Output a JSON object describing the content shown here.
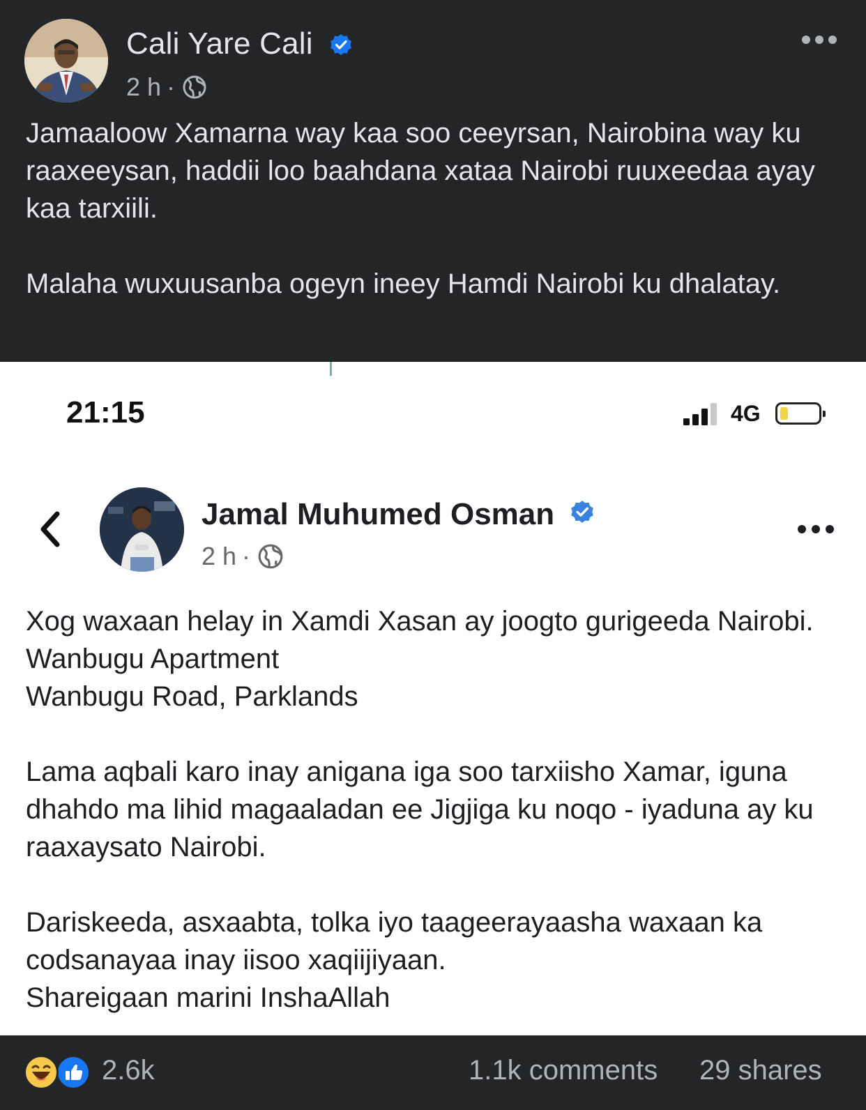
{
  "outer_post": {
    "author": "Cali Yare Cali",
    "time": "2 h",
    "separator": "·",
    "paragraphs": [
      "Jamaaloow Xamarna way kaa soo ceeyrsan, Nairobina way ku raaxeeysan, haddii loo baahdana xataa Nairobi ruuxeedaa ayay kaa tarxiili.",
      "Malaha wuxuusanba ogeyn ineey Hamdi Nairobi ku dhalatay."
    ],
    "icons": {
      "avatar": "profile-photo",
      "verified": "verified-badge-icon",
      "audience": "globe-icon",
      "more": "more-options-icon"
    },
    "colors": {
      "background": "#242527",
      "text": "#e4e6eb",
      "meta": "#b0b3b8",
      "verified": "#1877f2"
    }
  },
  "embedded_screenshot": {
    "status_bar": {
      "time": "21:15",
      "network": "4G",
      "battery_level": 0.2
    },
    "author": "Jamal Muhumed Osman",
    "time": "2 h",
    "separator": "·",
    "paragraphs": [
      "Xog waxaan helay in Xamdi Xasan ay joogto gurigeeda Nairobi.\nWanbugu Apartment\nWanbugu Road, Parklands",
      "Lama aqbali karo inay anigana iga soo tarxiisho Xamar, iguna dhahdo ma lihid magaaladan ee Jigjiga ku noqo - iyaduna ay ku raaxaysato Nairobi.",
      "Dariskeeda, asxaabta, tolka iyo taageerayaasha waxaan ka codsanayaa inay iisoo xaqiijiyaan.\nShareigaan marini InshaAllah"
    ],
    "icons": {
      "back": "back-arrow-icon",
      "verified": "verified-badge-icon",
      "audience": "globe-icon",
      "more": "more-options-icon"
    }
  },
  "footer": {
    "reactions": [
      "haha-reaction-icon",
      "like-reaction-icon"
    ],
    "reaction_count": "2.6k",
    "comments": "1.1k comments",
    "shares": "29 shares"
  }
}
